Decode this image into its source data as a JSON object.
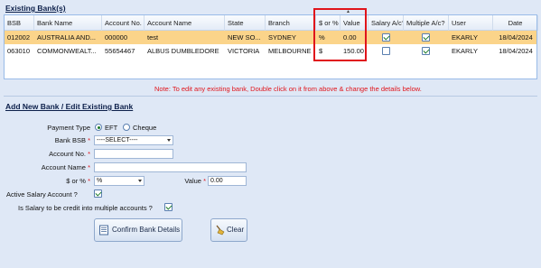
{
  "existing": {
    "title": "Existing Bank(s)",
    "columns": [
      "BSB",
      "Bank Name",
      "Account No.",
      "Account Name",
      "State",
      "Branch",
      "$ or %",
      "Value",
      "Salary A/c?",
      "Multiple A/c?",
      "User",
      "Date"
    ],
    "rows": [
      {
        "bsb": "012002",
        "bank": "AUSTRALIA AND...",
        "acc_no": "000000",
        "acc_name": "test",
        "state": "NEW SO...",
        "branch": "SYDNEY",
        "type": "%",
        "value": "0.00",
        "salary": true,
        "multiple": true,
        "user": "EKARLY",
        "date": "18/04/2024"
      },
      {
        "bsb": "063010",
        "bank": "COMMONWEALT...",
        "acc_no": "55654467",
        "acc_name": "ALBUS DUMBLEDORE",
        "state": "VICTORIA",
        "branch": "MELBOURNE",
        "type": "$",
        "value": "150.00",
        "salary": false,
        "multiple": true,
        "user": "EKARLY",
        "date": "18/04/2024"
      }
    ],
    "note": "Note: To edit any existing bank, Double click on it from above & change the details below."
  },
  "form": {
    "title": "Add New Bank / Edit Existing Bank",
    "payment_type_label": "Payment Type",
    "payment_eft": "EFT",
    "payment_cheque": "Cheque",
    "payment_selected": "EFT",
    "bank_bsb_label": "Bank BSB",
    "bank_bsb_value": "----SELECT----",
    "account_no_label": "Account No.",
    "account_no_value": "",
    "account_name_label": "Account Name",
    "account_name_value": "",
    "type_label": "$ or %",
    "type_value": "%",
    "value_label": "Value",
    "value_value": "0.00",
    "active_salary_label": "Active Salary Account ?",
    "active_salary_checked": true,
    "multiple_label": "Is Salary to be credit into multiple accounts ?",
    "multiple_checked": true,
    "required_mark": "*"
  },
  "buttons": {
    "confirm": "Confirm Bank Details",
    "clear": "Clear"
  },
  "colors": {
    "selected_row": "#fbd48a",
    "highlight_box": "#e0141b",
    "note": "#e0141b"
  }
}
